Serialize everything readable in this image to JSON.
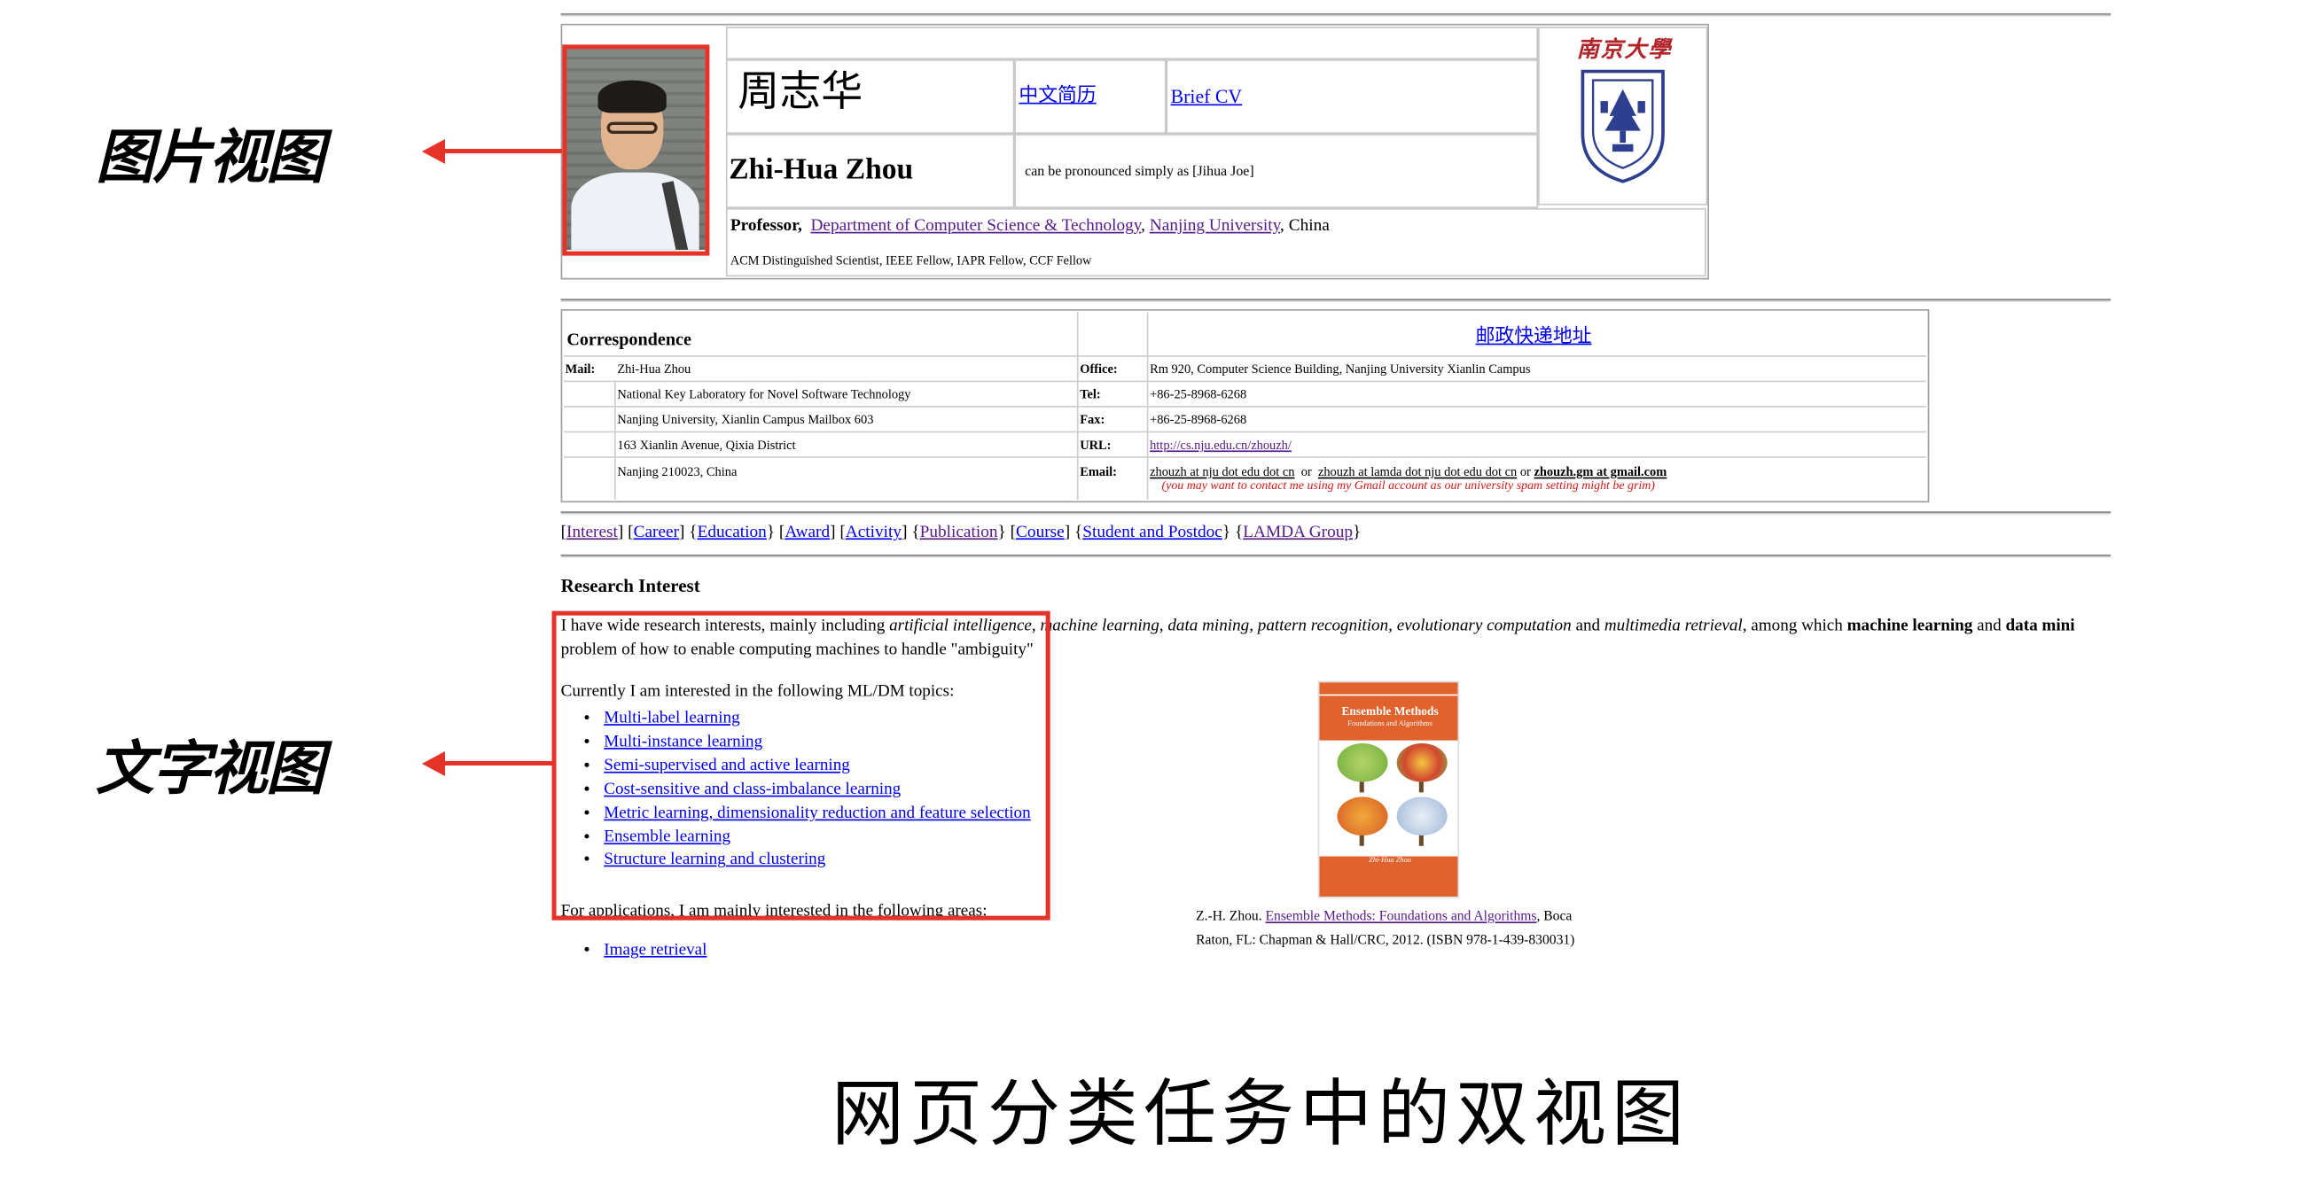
{
  "annotations": {
    "image_view_label": "图片视图",
    "text_view_label": "文字视图",
    "caption": "网页分类任务中的双视图"
  },
  "header": {
    "name_cn": "周志华",
    "link_cn_cv": "中文简历",
    "link_brief_cv": "Brief CV",
    "name_en": "Zhi-Hua Zhou",
    "pronounce": "can be pronounced simply as [Jihua Joe]",
    "title_label": "Professor,",
    "dept_link": "Department of Computer Science & Technology",
    "univ_link": "Nanjing University",
    "country": ", China",
    "fellow": "ACM Distinguished Scientist, IEEE Fellow, IAPR Fellow, CCF Fellow",
    "logo_title": "南京大學"
  },
  "correspondence": {
    "title": "Correspondence",
    "postal_link": "邮政快递地址",
    "mail_label": "Mail:",
    "mail_lines": [
      "Zhi-Hua Zhou",
      "National Key Laboratory for Novel Software Technology",
      "Nanjing University, Xianlin Campus Mailbox 603",
      "163 Xianlin Avenue, Qixia District",
      "Nanjing 210023, China"
    ],
    "office_label": "Office:",
    "office": "Rm 920, Computer Science Building, Nanjing University Xianlin Campus",
    "tel_label": "Tel:",
    "tel": "+86-25-8968-6268",
    "fax_label": "Fax:",
    "fax": "+86-25-8968-6268",
    "url_label": "URL:",
    "url": "http://cs.nju.edu.cn/zhouzh/",
    "email_label": "Email:",
    "email_1": "zhouzh at nju dot edu dot cn",
    "email_or1": "or",
    "email_2": "zhouzh at lamda dot nju dot edu dot cn",
    "email_or2": "or",
    "email_3": "zhouzh.gm at gmail.com",
    "gmail_note": "(you may want to contact me using my Gmail account as our university spam setting might be grim)"
  },
  "nav": {
    "items": [
      "Interest",
      "Career",
      "Education",
      "Award",
      "Activity",
      "Publication",
      "Course",
      "Student and Postdoc",
      "LAMDA Group"
    ]
  },
  "research": {
    "heading": "Research Interest",
    "p1_start": "I have wide research interests, mainly including ",
    "p1_ai": "artificial intelligence",
    "p1_sep": ", ",
    "p1_topics": "machine learning, data mining, pattern recognition, evolutionary computation",
    "p1_and": " and ",
    "p1_mr": "multimedia retrieval",
    "p1_among": ", among which ",
    "p1_ml": "machine learning",
    "p1_and2": " and ",
    "p1_dm": "data mini",
    "p1_line2": "problem of how to enable computing machines to handle \"ambiguity\"",
    "p2": "Currently I am interested in the following ML/DM topics:",
    "topics": [
      "Multi-label learning",
      "Multi-instance learning",
      "Semi-supervised and active learning",
      "Cost-sensitive and class-imbalance learning",
      "Metric learning, dimensionality reduction and feature selection",
      "Ensemble learning",
      "Structure learning and clustering"
    ],
    "p3": "For applications, I am mainly interested in the following areas:",
    "apps": [
      "Image retrieval"
    ]
  },
  "book": {
    "series": "Chapman & Hall/CRC Machine Learning & Pattern Recognition Series",
    "title": "Ensemble Methods",
    "subtitle": "Foundations and Algorithms",
    "author": "Zhi-Hua Zhou",
    "caption_prefix": "Z.-H. Zhou. ",
    "caption_link": "Ensemble Methods: Foundations and Algorithms",
    "caption_suffix": ", Boca",
    "caption_line2": "Raton, FL: Chapman & Hall/CRC, 2012. (ISBN 978-1-439-830031)"
  },
  "colors": {
    "highlight": "#e53329",
    "link": "#0000ee",
    "visited": "#551a8b",
    "note_red": "#d41818",
    "book_orange": "#e0622c",
    "logo_red": "#b1262b"
  }
}
